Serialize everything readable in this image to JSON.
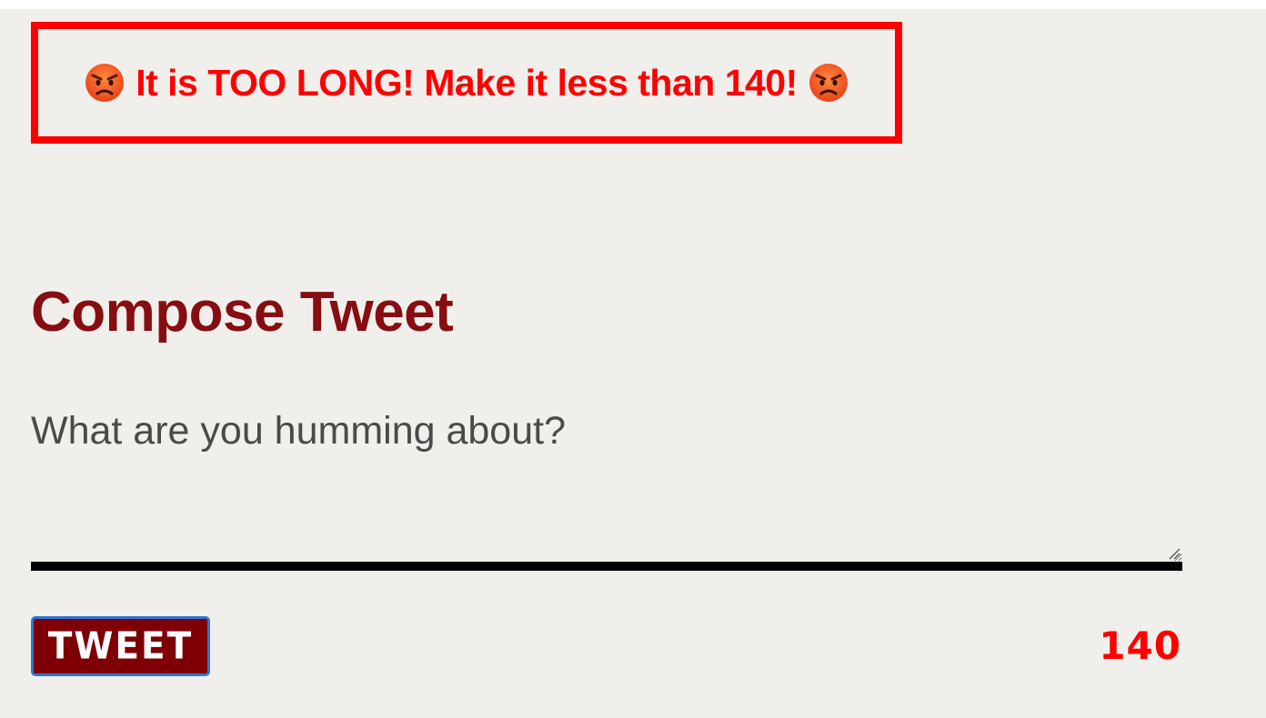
{
  "alert": {
    "message": "It is TOO LONG! Make it less than 140!",
    "icon": "angry-face-icon",
    "color": "#ff0000"
  },
  "compose": {
    "title": "Compose Tweet",
    "prompt": "What are you humming about?",
    "textarea_value": "",
    "title_color": "#860d11"
  },
  "actions": {
    "tweet_label": "TWEET",
    "button_color": "#7e0006",
    "button_border_color": "#2f74d0"
  },
  "counter": {
    "value": "140",
    "color": "#ff0000"
  },
  "background_color": "#f1efeb"
}
